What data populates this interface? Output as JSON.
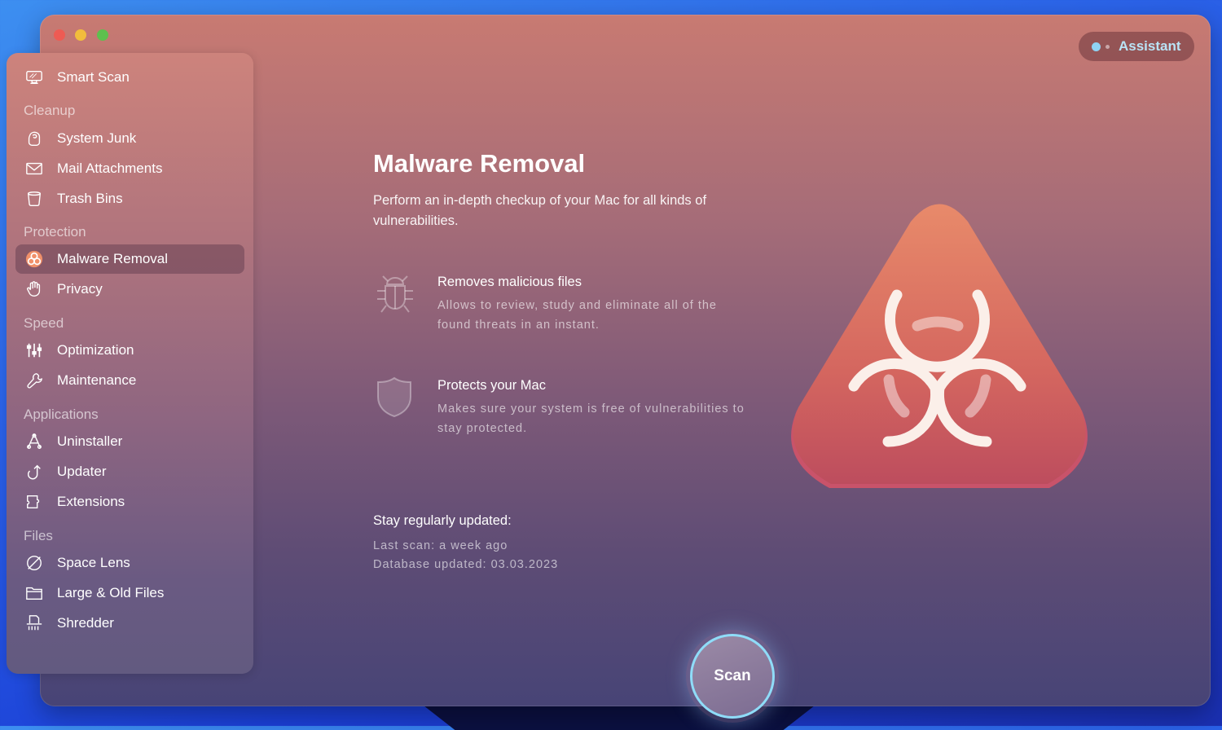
{
  "window": {
    "traffic_lights": [
      "close",
      "minimize",
      "maximize"
    ]
  },
  "assistant": {
    "label": "Assistant"
  },
  "sidebar": {
    "smart_scan": {
      "label": "Smart Scan",
      "icon": "monitor-icon"
    },
    "sections": [
      {
        "title": "Cleanup",
        "items": [
          {
            "label": "System Junk",
            "icon": "junk-icon"
          },
          {
            "label": "Mail Attachments",
            "icon": "mail-icon"
          },
          {
            "label": "Trash Bins",
            "icon": "trash-icon"
          }
        ]
      },
      {
        "title": "Protection",
        "items": [
          {
            "label": "Malware Removal",
            "icon": "biohazard-icon",
            "active": true
          },
          {
            "label": "Privacy",
            "icon": "hand-icon"
          }
        ]
      },
      {
        "title": "Speed",
        "items": [
          {
            "label": "Optimization",
            "icon": "sliders-icon"
          },
          {
            "label": "Maintenance",
            "icon": "wrench-icon"
          }
        ]
      },
      {
        "title": "Applications",
        "items": [
          {
            "label": "Uninstaller",
            "icon": "uninstaller-icon"
          },
          {
            "label": "Updater",
            "icon": "update-arrow-icon"
          },
          {
            "label": "Extensions",
            "icon": "puzzle-icon"
          }
        ]
      },
      {
        "title": "Files",
        "items": [
          {
            "label": "Space Lens",
            "icon": "planet-icon"
          },
          {
            "label": "Large & Old Files",
            "icon": "folder-icon"
          },
          {
            "label": "Shredder",
            "icon": "shredder-icon"
          }
        ]
      }
    ]
  },
  "main": {
    "title": "Malware Removal",
    "subtitle": "Perform an in-depth checkup of your Mac for all kinds of vulnerabilities.",
    "features": [
      {
        "title": "Removes malicious files",
        "description": "Allows to review, study and eliminate all of the found threats in an instant.",
        "icon": "bug-icon"
      },
      {
        "title": "Protects your Mac",
        "description": "Makes sure your system is free of vulnerabilities to stay protected.",
        "icon": "shield-icon"
      }
    ],
    "update": {
      "title": "Stay regularly updated:",
      "last_scan": "Last scan: a week ago",
      "database": "Database updated: 03.03.2023"
    },
    "hero_icon": "biohazard-warning-icon",
    "scan_button": "Scan"
  },
  "colors": {
    "accent": "#8fdcf8",
    "hero_top": "#e88a6a",
    "hero_bottom": "#c04f5e"
  }
}
